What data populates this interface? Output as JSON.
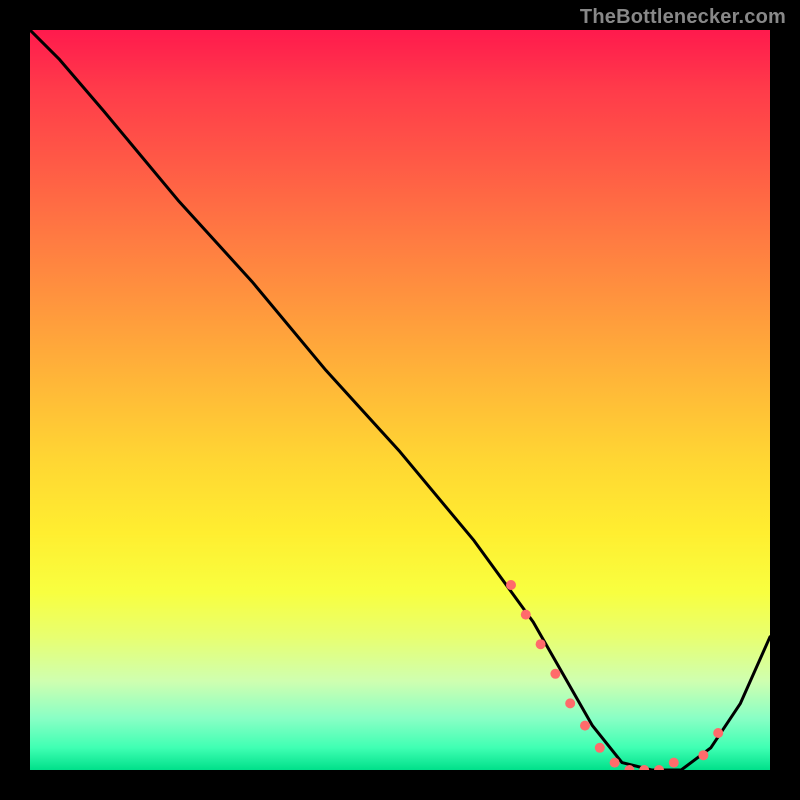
{
  "watermark": "TheBottlenecker.com",
  "chart_data": {
    "type": "line",
    "title": "",
    "xlabel": "",
    "ylabel": "",
    "xlim": [
      0,
      100
    ],
    "ylim": [
      0,
      100
    ],
    "background_gradient": {
      "orientation": "vertical",
      "stops": [
        {
          "pos": 0.0,
          "color": "#ff1a4d"
        },
        {
          "pos": 0.5,
          "color": "#ffd633"
        },
        {
          "pos": 0.85,
          "color": "#e8ff70"
        },
        {
          "pos": 1.0,
          "color": "#00e08a"
        }
      ]
    },
    "series": [
      {
        "name": "bottleneck-curve",
        "color": "#000000",
        "x": [
          0,
          4,
          10,
          20,
          30,
          40,
          50,
          60,
          68,
          72,
          76,
          80,
          84,
          88,
          92,
          96,
          100
        ],
        "y": [
          100,
          96,
          89,
          77,
          66,
          54,
          43,
          31,
          20,
          13,
          6,
          1,
          0,
          0,
          3,
          9,
          18
        ]
      }
    ],
    "markers": {
      "name": "highlight-dots",
      "color": "#ff6b6b",
      "radius": 5,
      "points": [
        {
          "x": 65,
          "y": 25
        },
        {
          "x": 67,
          "y": 21
        },
        {
          "x": 69,
          "y": 17
        },
        {
          "x": 71,
          "y": 13
        },
        {
          "x": 73,
          "y": 9
        },
        {
          "x": 75,
          "y": 6
        },
        {
          "x": 77,
          "y": 3
        },
        {
          "x": 79,
          "y": 1
        },
        {
          "x": 81,
          "y": 0
        },
        {
          "x": 83,
          "y": 0
        },
        {
          "x": 85,
          "y": 0
        },
        {
          "x": 87,
          "y": 1
        },
        {
          "x": 91,
          "y": 2
        },
        {
          "x": 93,
          "y": 5
        }
      ]
    }
  }
}
